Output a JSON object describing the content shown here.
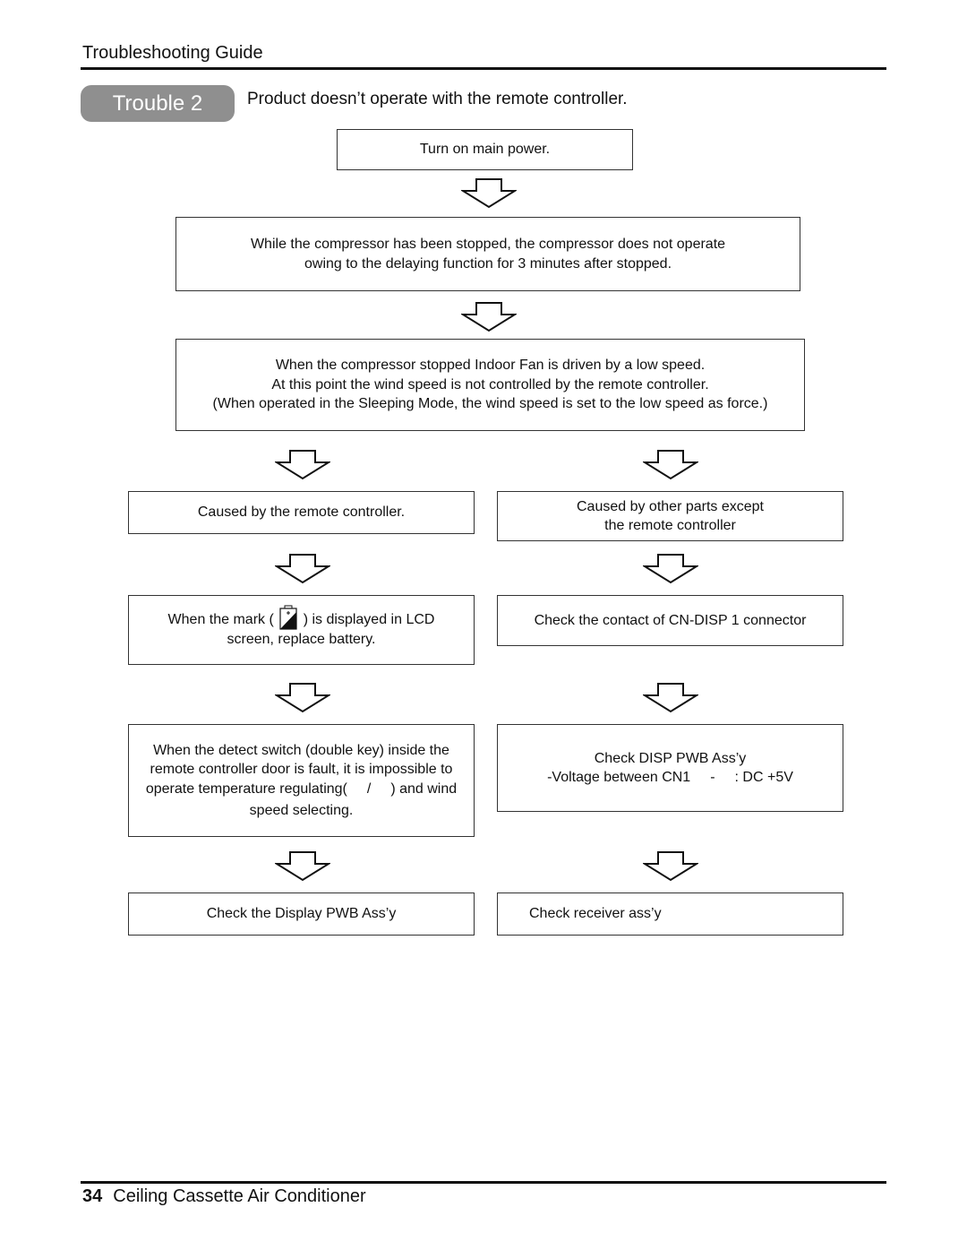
{
  "header": {
    "section_title": "Troubleshooting Guide",
    "badge_label": "Trouble 2",
    "trouble_description": "Product doesn’t operate with the remote controller."
  },
  "flow": {
    "step1": "Turn on main power.",
    "step2": {
      "line1": "While the compressor has been stopped, the compressor does not operate",
      "line2": "owing to the delaying function for 3 minutes after stopped."
    },
    "step3": {
      "line1": "When the compressor stopped Indoor Fan is driven by a low speed.",
      "line2": "At this point the wind speed is not controlled by the remote controller.",
      "line3": "(When operated in the Sleeping Mode, the wind speed is set to the low speed as force.)"
    },
    "left": {
      "cause": "Caused by the remote controller.",
      "battery": {
        "part1": "When the mark (",
        "icon": "battery-low-icon",
        "part2": ") is displayed in LCD",
        "line2": "screen, replace battery."
      },
      "detect_switch": {
        "line1": "When the detect switch (double key) inside the",
        "line2": "remote controller door is fault, it is impossible to",
        "line3a": "operate temperature regulating(",
        "line3b": "/",
        "line3c": ") and wind",
        "line4": "speed selecting."
      },
      "final": "Check the Display PWB Ass’y"
    },
    "right": {
      "cause": {
        "line1": "Caused by other parts except",
        "line2": "the remote controller"
      },
      "contact": "Check the contact of CN-DISP 1 connector",
      "disp_pwb": {
        "line1": "Check DISP PWB Ass’y",
        "line2a": "-Voltage between CN1",
        "line2b": "-",
        "line2c": ": DC +5V"
      },
      "final": "Check receiver ass’y"
    },
    "arrow_icon": "down-arrow-icon"
  },
  "footer": {
    "page_number": "34",
    "title": "Ceiling Cassette Air Conditioner"
  }
}
